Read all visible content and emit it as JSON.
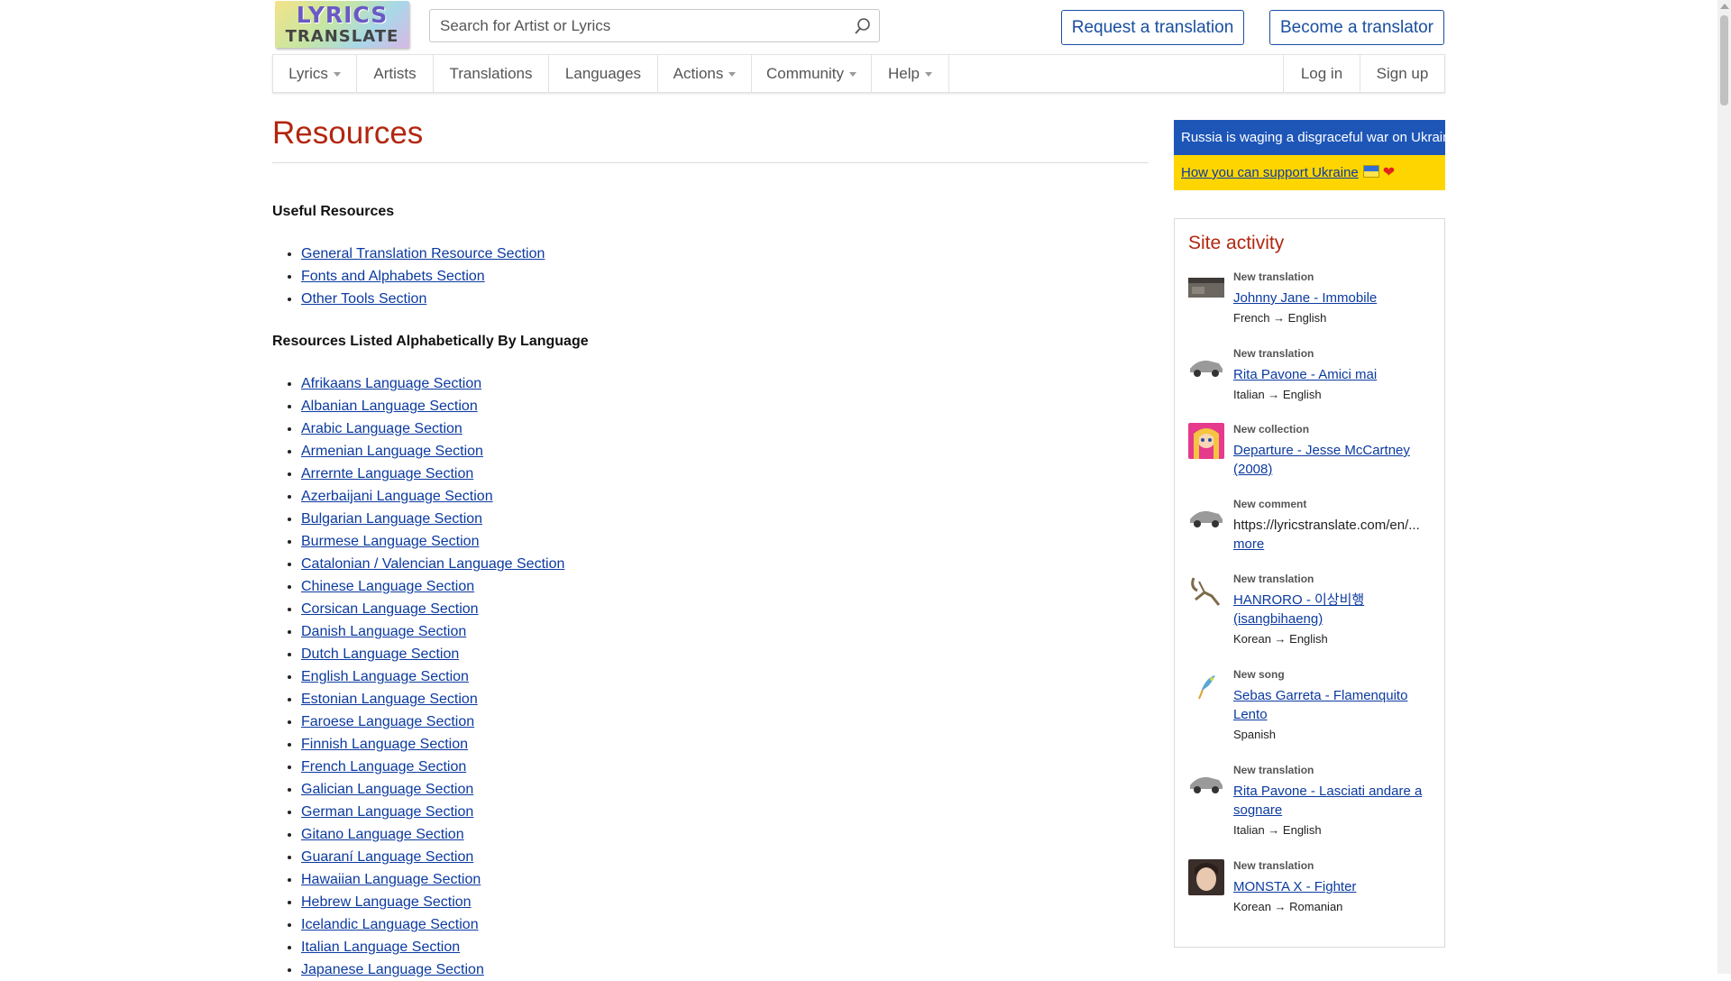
{
  "header": {
    "logo_line1": "LYRICS",
    "logo_line2": "TRANSLATE",
    "search_placeholder": "Search for Artist or Lyrics",
    "request_label": "Request a translation",
    "become_label": "Become a translator"
  },
  "nav": {
    "lyrics": "Lyrics",
    "artists": "Artists",
    "translations": "Translations",
    "languages": "Languages",
    "actions": "Actions",
    "community": "Community",
    "help": "Help",
    "login": "Log in",
    "signup": "Sign up"
  },
  "main": {
    "title": "Resources",
    "useful_heading": "Useful Resources",
    "useful_links": [
      "General Translation Resource Section",
      "Fonts and Alphabets Section",
      "Other Tools Section"
    ],
    "alpha_heading": "Resources Listed Alphabetically By Language",
    "language_links": [
      "Afrikaans Language Section",
      "Albanian Language Section",
      "Arabic Language Section",
      "Armenian Language Section",
      "Arrernte Language Section",
      "Azerbaijani Language Section",
      "Bulgarian Language Section",
      "Burmese Language Section",
      "Catalonian / Valencian Language Section",
      "Chinese Language Section",
      "Corsican Language Section",
      "Danish Language Section",
      "Dutch Language Section",
      "English Language Section",
      "Estonian Language Section",
      "Faroese Language Section",
      "Finnish Language Section",
      "French Language Section",
      "Galician Language Section",
      "German Language Section",
      "Gitano Language Section",
      "Guaraní Language Section",
      "Hawaiian Language Section",
      "Hebrew Language Section",
      "Icelandic Language Section",
      "Italian Language Section",
      "Japanese Language Section"
    ]
  },
  "sidebar": {
    "ukraine_banner": "Russia is waging a disgraceful war on Ukraine.",
    "ukraine_link": "How you can support Ukraine",
    "activity_title": "Site activity",
    "activity": [
      {
        "kind": "New translation",
        "title": "Johnny Jane - Immobile",
        "langs": "French → English",
        "thumb": "photo-icon"
      },
      {
        "kind": "New translation",
        "title": "Rita Pavone - Amici mai",
        "langs": "Italian → English",
        "thumb": "car-icon"
      },
      {
        "kind": "New collection",
        "title": "Departure - Jesse McCartney (2008)",
        "langs": "",
        "thumb": "anime-avatar-icon"
      },
      {
        "kind": "New comment",
        "text": "https://lyricstranslate.com/en/...",
        "more": "more",
        "langs": "",
        "thumb": "car-icon"
      },
      {
        "kind": "New translation",
        "title": "HANRORO - 이상비행 (isangbihaeng)",
        "langs": "Korean → English",
        "thumb": "scorpion-icon"
      },
      {
        "kind": "New song",
        "title": "Sebas Garreta - Flamenquito Lento",
        "langs": "Spanish",
        "thumb": "bird-icon"
      },
      {
        "kind": "New translation",
        "title": "Rita Pavone - Lasciati andare a sognare",
        "langs": "Italian → English",
        "thumb": "car-icon"
      },
      {
        "kind": "New translation",
        "title": "MONSTA X - Fighter",
        "langs": "Korean → Romanian",
        "thumb": "portrait-icon"
      }
    ]
  },
  "colors": {
    "accent_red": "#b3260f",
    "link_blue": "#0b3aa0",
    "ukraine_blue": "#1e56b8",
    "ukraine_yellow": "#ffd500"
  }
}
